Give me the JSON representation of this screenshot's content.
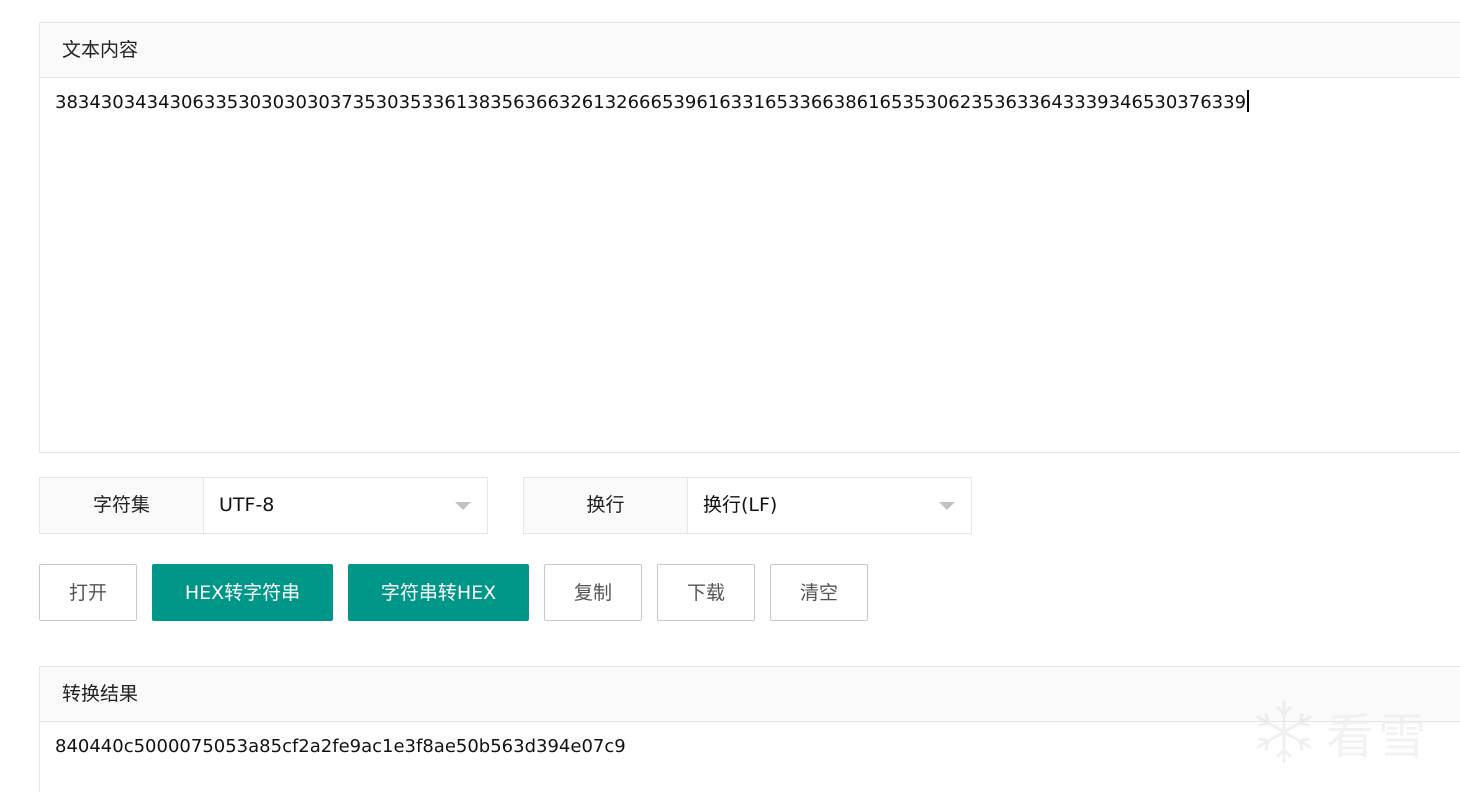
{
  "input_panel": {
    "title": "文本内容",
    "content": "38343034343063353030303037353035336138356366326132666539616331653366386165353062353633643339346530376339"
  },
  "charset": {
    "label": "字符集",
    "value": "UTF-8"
  },
  "newline": {
    "label": "换行",
    "value": "换行(LF)"
  },
  "buttons": {
    "open": "打开",
    "hex_to_string": "HEX转字符串",
    "string_to_hex": "字符串转HEX",
    "copy": "复制",
    "download": "下载",
    "clear": "清空"
  },
  "result_panel": {
    "title": "转换结果",
    "content": "840440c5000075053a85cf2a2fe9ac1e3f8ae50b563d394e07c9"
  },
  "watermark": {
    "text": "看雪",
    "icon": "snowflake-icon"
  },
  "colors": {
    "primary": "#009688",
    "border": "#e6e6e6",
    "header_bg": "#fafafa"
  }
}
